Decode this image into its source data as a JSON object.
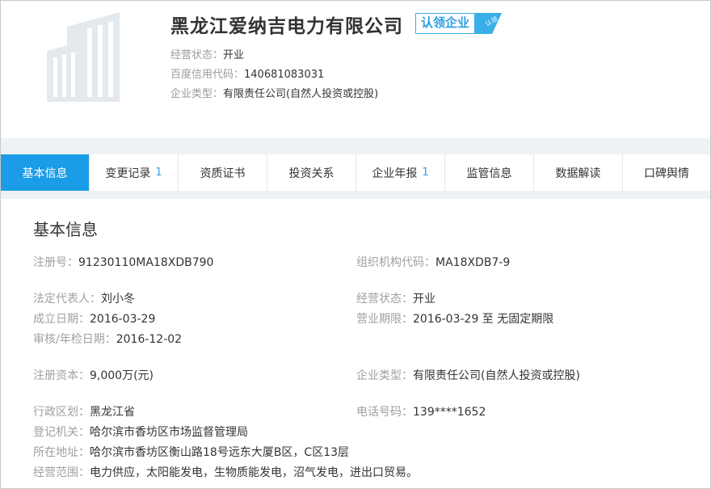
{
  "company": {
    "name": "黑龙江爱纳吉电力有限公司",
    "claim_badge": "认领企业",
    "claim_tag": "认领"
  },
  "header_info": [
    {
      "label": "经营状态：",
      "value": "开业"
    },
    {
      "label": "百度信用代码：",
      "value": "140681083031"
    },
    {
      "label": "企业类型：",
      "value": "有限责任公司(自然人投资或控股)"
    }
  ],
  "tabs": [
    {
      "label": "基本信息",
      "badge": ""
    },
    {
      "label": "变更记录",
      "badge": "1"
    },
    {
      "label": "资质证书",
      "badge": ""
    },
    {
      "label": "投资关系",
      "badge": ""
    },
    {
      "label": "企业年报",
      "badge": "1"
    },
    {
      "label": "监管信息",
      "badge": ""
    },
    {
      "label": "数据解读",
      "badge": ""
    },
    {
      "label": "口碑舆情",
      "badge": ""
    }
  ],
  "basic": {
    "title": "基本信息",
    "fields": {
      "reg_no": {
        "label": "注册号：",
        "value": "91230110MA18XDB790"
      },
      "org_code": {
        "label": "组织机构代码：",
        "value": "MA18XDB7-9"
      },
      "legal_rep": {
        "label": "法定代表人：",
        "value": "刘小冬"
      },
      "status": {
        "label": "经营状态：",
        "value": "开业"
      },
      "est_date": {
        "label": "成立日期：",
        "value": "2016-03-29"
      },
      "term": {
        "label": "营业期限：",
        "value": "2016-03-29 至 无固定期限"
      },
      "audit_date": {
        "label": "审核/年检日期：",
        "value": "2016-12-02"
      },
      "capital": {
        "label": "注册资本：",
        "value": "9,000万(元)"
      },
      "ent_type": {
        "label": "企业类型：",
        "value": "有限责任公司(自然人投资或控股)"
      },
      "region": {
        "label": "行政区划：",
        "value": "黑龙江省"
      },
      "phone": {
        "label": "电话号码：",
        "value": "139****1652"
      },
      "authority": {
        "label": "登记机关：",
        "value": "哈尔滨市香坊区市场监督管理局"
      },
      "address": {
        "label": "所在地址：",
        "value": "哈尔滨市香坊区衡山路18号远东大厦B区，C区13层"
      },
      "scope": {
        "label": "经营范围：",
        "value": "电力供应，太阳能发电，生物质能发电，沼气发电，进出口贸易。"
      }
    }
  },
  "colors": {
    "accent": "#1a9ce6",
    "badge_blue": "#2d9fe0",
    "band": "#edf2f6"
  }
}
